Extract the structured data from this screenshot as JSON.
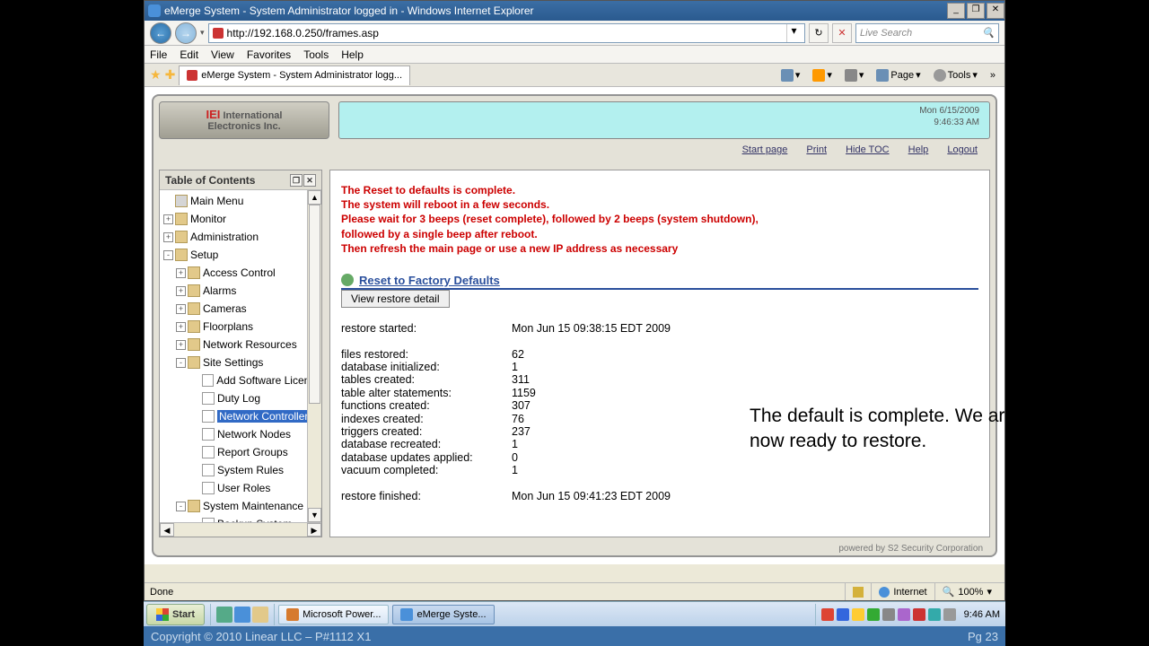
{
  "titlebar": {
    "title": "eMerge System - System Administrator logged in        - Windows Internet Explorer"
  },
  "address": {
    "url": "http://192.168.0.250/frames.asp"
  },
  "search": {
    "placeholder": "Live Search"
  },
  "menu": {
    "file": "File",
    "edit": "Edit",
    "view": "View",
    "favorites": "Favorites",
    "tools": "Tools",
    "help": "Help"
  },
  "tab": {
    "title": "eMerge System - System Administrator logg..."
  },
  "cmdbar": {
    "page": "Page",
    "tools": "Tools"
  },
  "logo": {
    "brand": "IEI",
    "line1": "International",
    "line2": "Electronics Inc."
  },
  "datetime": {
    "date": "Mon 6/15/2009",
    "time": "9:46:33 AM"
  },
  "links": {
    "start": "Start page",
    "print": "Print",
    "hide": "Hide TOC",
    "help": "Help",
    "logout": "Logout"
  },
  "toc": {
    "title": "Table of Contents",
    "items": [
      {
        "lvl": 0,
        "tog": "",
        "ico": "home",
        "label": "Main Menu"
      },
      {
        "lvl": 0,
        "tog": "+",
        "ico": "folder",
        "label": "Monitor"
      },
      {
        "lvl": 0,
        "tog": "+",
        "ico": "folder",
        "label": "Administration"
      },
      {
        "lvl": 0,
        "tog": "-",
        "ico": "folder",
        "label": "Setup"
      },
      {
        "lvl": 1,
        "tog": "+",
        "ico": "folder",
        "label": "Access Control"
      },
      {
        "lvl": 1,
        "tog": "+",
        "ico": "folder",
        "label": "Alarms"
      },
      {
        "lvl": 1,
        "tog": "+",
        "ico": "folder",
        "label": "Cameras"
      },
      {
        "lvl": 1,
        "tog": "+",
        "ico": "folder",
        "label": "Floorplans"
      },
      {
        "lvl": 1,
        "tog": "+",
        "ico": "folder",
        "label": "Network Resources"
      },
      {
        "lvl": 1,
        "tog": "-",
        "ico": "folder",
        "label": "Site Settings"
      },
      {
        "lvl": 2,
        "tog": "",
        "ico": "page",
        "label": "Add Software License"
      },
      {
        "lvl": 2,
        "tog": "",
        "ico": "page",
        "label": "Duty Log"
      },
      {
        "lvl": 2,
        "tog": "",
        "ico": "page",
        "label": "Network Controller",
        "sel": true
      },
      {
        "lvl": 2,
        "tog": "",
        "ico": "page",
        "label": "Network Nodes"
      },
      {
        "lvl": 2,
        "tog": "",
        "ico": "page",
        "label": "Report Groups"
      },
      {
        "lvl": 2,
        "tog": "",
        "ico": "page",
        "label": "System Rules"
      },
      {
        "lvl": 2,
        "tog": "",
        "ico": "page",
        "label": "User Roles"
      },
      {
        "lvl": 1,
        "tog": "-",
        "ico": "folder",
        "label": "System Maintenance"
      },
      {
        "lvl": 2,
        "tog": "",
        "ico": "page",
        "label": "Backup System"
      }
    ]
  },
  "reset": {
    "l1": "The Reset to defaults is complete.",
    "l2": "The system will reboot in a few seconds.",
    "l3": "Please wait for 3 beeps (reset complete), followed by 2 beeps (system shutdown),",
    "l4": "followed by a single beep after reboot.",
    "l5": "Then refresh the main page or use a new IP address as necessary"
  },
  "section": {
    "title": "Reset to Factory Defaults",
    "button": "View restore detail"
  },
  "log": {
    "rows": [
      {
        "k": "restore started:",
        "v": "Mon Jun 15 09:38:15 EDT 2009"
      },
      {
        "k": "",
        "v": ""
      },
      {
        "k": "files restored:",
        "v": "62"
      },
      {
        "k": "database initialized:",
        "v": "1"
      },
      {
        "k": "tables created:",
        "v": "311"
      },
      {
        "k": "table alter statements:",
        "v": "1159"
      },
      {
        "k": "functions created:",
        "v": "307"
      },
      {
        "k": "indexes created:",
        "v": "76"
      },
      {
        "k": "triggers created:",
        "v": "237"
      },
      {
        "k": "database recreated:",
        "v": "1"
      },
      {
        "k": "database updates applied:",
        "v": "0"
      },
      {
        "k": "vacuum completed:",
        "v": "1"
      },
      {
        "k": "",
        "v": ""
      },
      {
        "k": "restore finished:",
        "v": "Mon Jun 15 09:41:23 EDT 2009"
      }
    ]
  },
  "footer": {
    "brand": "powered by S2 Security Corporation"
  },
  "status": {
    "done": "Done",
    "zone": "Internet",
    "zoom": "100%"
  },
  "annotation": {
    "text": "The default is complete. We are now ready to restore."
  },
  "taskbar": {
    "start": "Start",
    "btn1": "Microsoft Power...",
    "btn2": "eMerge Syste...",
    "clock": "9:46 AM"
  },
  "bottom": {
    "copyright": "Copyright © 2010 Linear LLC – P#1112 X1",
    "page": "Pg 23"
  }
}
